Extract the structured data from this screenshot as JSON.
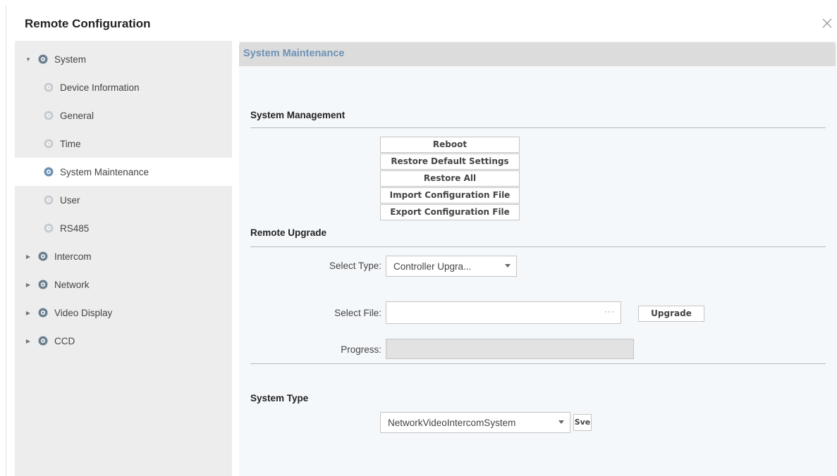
{
  "window": {
    "title": "Remote Configuration"
  },
  "sidebar": {
    "items": [
      {
        "label": "System",
        "level": 0,
        "expanded": true
      },
      {
        "label": "Device Information",
        "level": 1
      },
      {
        "label": "General",
        "level": 1
      },
      {
        "label": "Time",
        "level": 1
      },
      {
        "label": "System Maintenance",
        "level": 1,
        "selected": true
      },
      {
        "label": "User",
        "level": 1
      },
      {
        "label": "RS485",
        "level": 1
      },
      {
        "label": "Intercom",
        "level": 0,
        "expanded": false
      },
      {
        "label": "Network",
        "level": 0,
        "expanded": false
      },
      {
        "label": "Video Display",
        "level": 0,
        "expanded": false
      },
      {
        "label": "CCD",
        "level": 0,
        "expanded": false
      }
    ]
  },
  "main": {
    "header": "System Maintenance",
    "system_management": {
      "title": "System Management",
      "buttons": [
        "Reboot",
        "Restore Default Settings",
        "Restore All",
        "Import Configuration File",
        "Export Configuration File"
      ]
    },
    "remote_upgrade": {
      "title": "Remote Upgrade",
      "select_type_label": "Select Type:",
      "select_type_value": "Controller Upgra...",
      "select_file_label": "Select File:",
      "select_file_value": "",
      "browse_label": "···",
      "upgrade_label": "Upgrade",
      "progress_label": "Progress:",
      "progress_value": 0
    },
    "system_type": {
      "title": "System Type",
      "value": "NetworkVideoIntercomSystem",
      "save_label": "Sve"
    }
  },
  "colors": {
    "accent": "#6e92b5",
    "sidebar_bg": "#ededed",
    "header_bg": "#dcdcdc"
  }
}
